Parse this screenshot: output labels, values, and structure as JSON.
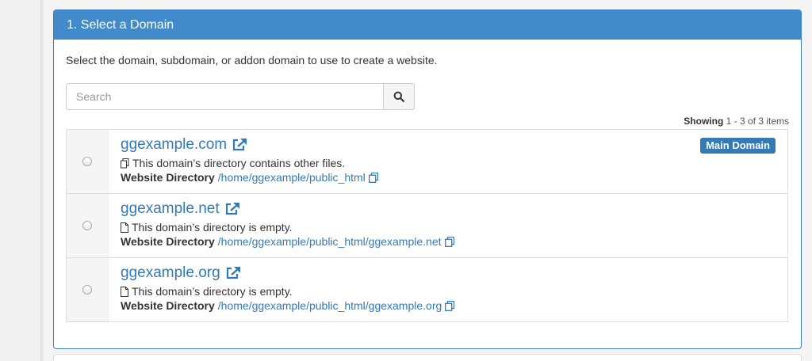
{
  "panel": {
    "title": "1. Select a Domain",
    "description": "Select the domain, subdomain, or addon domain to use to create a website."
  },
  "search": {
    "placeholder": "Search",
    "value": "",
    "button_icon": "search-icon"
  },
  "showing": {
    "label": "Showing",
    "range": "1 - 3 of 3 items"
  },
  "domains": [
    {
      "name": "ggexample.com",
      "status": "This domain’s directory contains other files.",
      "status_icon": "files-icon",
      "directory_label": "Website Directory",
      "directory_path": "/home/ggexample/public_html",
      "badge": "Main Domain",
      "selected": false
    },
    {
      "name": "ggexample.net",
      "status": "This domain’s directory is empty.",
      "status_icon": "file-icon",
      "directory_label": "Website Directory",
      "directory_path": "/home/ggexample/public_html/ggexample.net",
      "badge": "",
      "selected": false
    },
    {
      "name": "ggexample.org",
      "status": "This domain’s directory is empty.",
      "status_icon": "file-icon",
      "directory_label": "Website Directory",
      "directory_path": "/home/ggexample/public_html/ggexample.org",
      "badge": "",
      "selected": false
    }
  ],
  "colors": {
    "heading_bg": "#428bca",
    "link": "#337ab7",
    "badge_bg": "#337ab7"
  }
}
